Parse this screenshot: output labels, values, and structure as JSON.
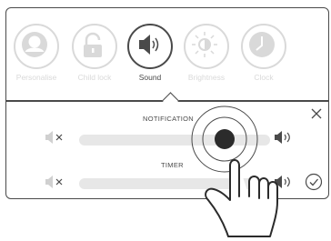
{
  "menu": {
    "items": [
      {
        "id": "personalise",
        "label": "Personalise",
        "icon": "person-icon"
      },
      {
        "id": "child_lock",
        "label": "Child lock",
        "icon": "padlock-icon"
      },
      {
        "id": "sound",
        "label": "Sound",
        "icon": "speaker-icon",
        "active": true
      },
      {
        "id": "brightness",
        "label": "Brightness",
        "icon": "sun-icon"
      },
      {
        "id": "clock",
        "label": "Clock",
        "icon": "clock-icon"
      }
    ]
  },
  "sliders": {
    "notification": {
      "label": "NOTIFICATION",
      "value": 0.86
    },
    "timer": {
      "label": "TIMER",
      "value": 0.72
    }
  },
  "colors": {
    "outline": "#4a4a4a",
    "inactive": "#d9d9d9",
    "track": "#e7e7e7",
    "knob": "#2b2b2b"
  }
}
